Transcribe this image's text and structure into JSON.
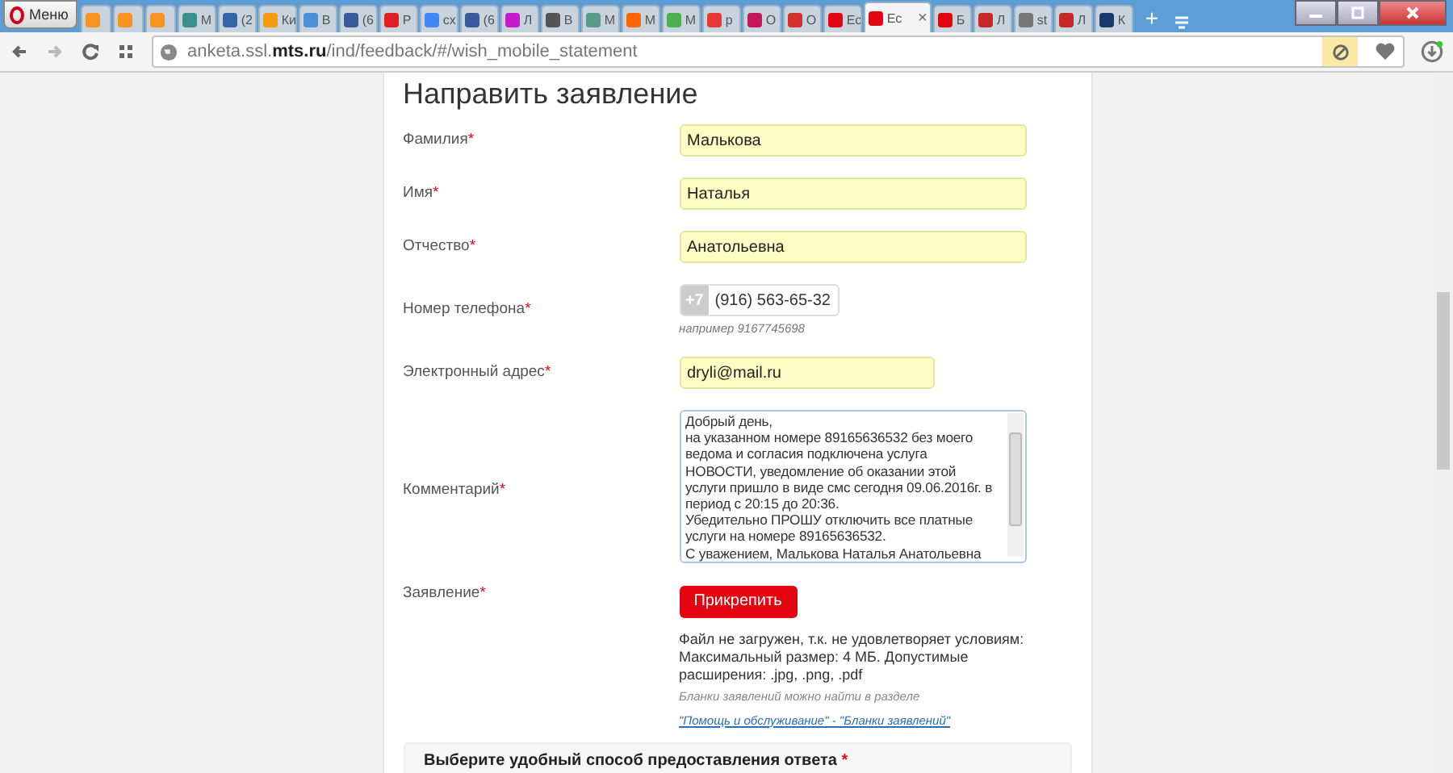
{
  "browser": {
    "menu_label": "Меню",
    "tabs": [
      {
        "color": "#f7931e",
        "selected": false
      },
      {
        "color": "#f7931e",
        "selected": false
      },
      {
        "color": "#f7931e",
        "selected": false
      },
      {
        "label": "М",
        "color": "#3a8f8a",
        "selected": false
      },
      {
        "label": "(2",
        "color": "#3465a4",
        "selected": false
      },
      {
        "label": "Ки",
        "color": "#f39c12",
        "selected": false
      },
      {
        "label": "В",
        "color": "#4a90d9",
        "selected": false
      },
      {
        "label": "(6",
        "color": "#3b5998",
        "selected": false
      },
      {
        "label": "Р",
        "color": "#e02020",
        "selected": false
      },
      {
        "label": "сх",
        "color": "#4285f4",
        "selected": false
      },
      {
        "label": "(6",
        "color": "#3b5998",
        "selected": false
      },
      {
        "label": "Л",
        "color": "#c21cc9",
        "selected": false
      },
      {
        "label": "В",
        "color": "#555555",
        "selected": false
      },
      {
        "label": "М",
        "color": "#5a9a8a",
        "selected": false
      },
      {
        "label": "М",
        "color": "#ff6600",
        "selected": false
      },
      {
        "label": "М",
        "color": "#4caf50",
        "selected": false
      },
      {
        "label": "р",
        "color": "#e53935",
        "selected": false
      },
      {
        "label": "О",
        "color": "#c2185b",
        "selected": false
      },
      {
        "label": "О",
        "color": "#d32f2f",
        "selected": false
      },
      {
        "label": "Ес",
        "color": "#e30611",
        "selected": false
      },
      {
        "label": "Ес",
        "color": "#e30611",
        "selected": true
      },
      {
        "label": "Б",
        "color": "#e30611",
        "selected": false
      },
      {
        "label": "Л",
        "color": "#c62828",
        "selected": false
      },
      {
        "label": "st",
        "color": "#777777",
        "selected": false
      },
      {
        "label": "Л",
        "color": "#c62828",
        "selected": false
      },
      {
        "label": "К",
        "color": "#1a3a6a",
        "selected": false
      }
    ],
    "close_tab": "×",
    "new_tab": "+",
    "url_host": "anketa.ssl.",
    "url_domain": "mts.ru",
    "url_path": "/ind/feedback/#/wish_mobile_statement"
  },
  "form": {
    "title": "Направить заявление",
    "fields": [
      {
        "kind": "text",
        "label": "Фамилия",
        "mark": "*",
        "value": "Малькова"
      },
      {
        "kind": "text",
        "label": "Имя",
        "mark": "*",
        "value": "Наталья"
      },
      {
        "kind": "text",
        "label": "Отчество",
        "mark": "*",
        "value": "Анатольевна"
      },
      {
        "kind": "phone",
        "label": "Номер телефона",
        "mark": "*",
        "prefix": "+7",
        "value": "(916) 563-65-32",
        "hint": "например 9167745698"
      },
      {
        "kind": "email",
        "label": "Электронный адрес",
        "mark": "*",
        "value": "dryli@mail.ru"
      },
      {
        "kind": "textarea",
        "label": "Комментарий",
        "mark": "*",
        "lines": [
          "Добрый день,",
          "на указанном номере 89165636532 без моего",
          "ведома и согласия подключена услуга",
          "НОВОСТИ, уведомление об оказании этой",
          "услуги пришло в виде смс сегодня 09.06.2016г. в",
          "период с 20:15 до 20:36.",
          "Убедительно ПРОШУ отключить все платные",
          "услуги на номере 89165636532.",
          "С уважением, Малькова Наталья Анатольевна"
        ]
      },
      {
        "kind": "file",
        "label": "Заявление",
        "mark": "*",
        "button": "Прикрепить",
        "error": "Файл не загружен, т.к. не удовлетворяет условиям: Максимальный размер: 4 МБ. Допустимые расширения: .jpg, .png, .pdf",
        "note": "Бланки заявлений можно найти в разделе",
        "link": "\"Помощь и обслуживание\" - \"Бланки заявлений\""
      }
    ],
    "answer_title": "Выберите удобный способ предоставления ответа",
    "answer_mark": "*"
  }
}
